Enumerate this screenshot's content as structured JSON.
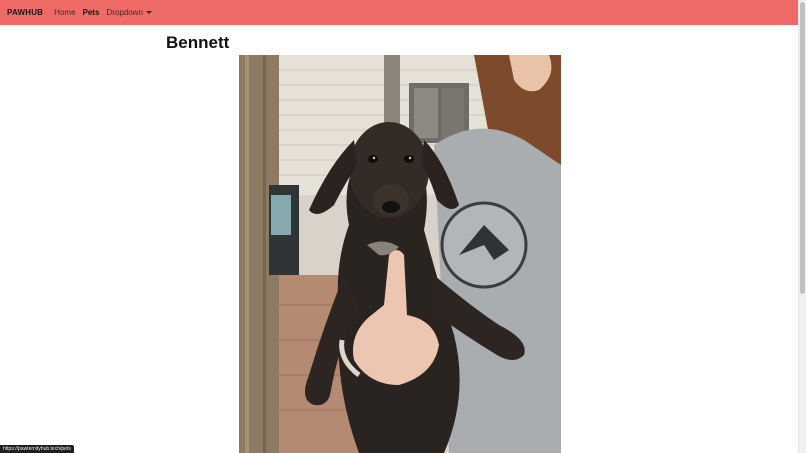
{
  "navbar": {
    "brand": "PAWHUB",
    "items": [
      {
        "label": "Home",
        "active": false
      },
      {
        "label": "Pets",
        "active": true
      },
      {
        "label": "Dropdown",
        "active": false
      }
    ],
    "color": "#ef6b67"
  },
  "pet": {
    "name": "Bennett",
    "image_alt": "dog-photo"
  },
  "status_bar": {
    "url": "https://pawternityhub.tech/pets"
  }
}
